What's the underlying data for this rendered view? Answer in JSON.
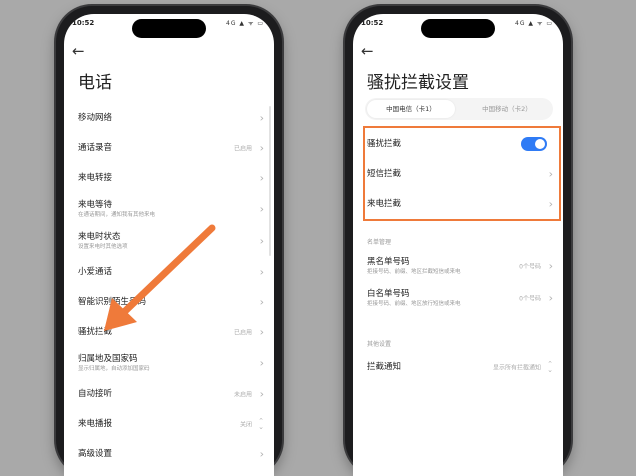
{
  "left_phone": {
    "status": {
      "time": "10:52",
      "indicators": "4G ▲ ᯤ ▭"
    },
    "title": "电话",
    "items": [
      {
        "label": "移动网络",
        "sub": "",
        "value": "",
        "control": "chevron"
      },
      {
        "label": "通话录音",
        "sub": "",
        "value": "已启用",
        "control": "chevron"
      },
      {
        "label": "来电转接",
        "sub": "",
        "value": "",
        "control": "chevron"
      },
      {
        "label": "来电等待",
        "sub": "在通话期间，通知我有其他来电",
        "value": "",
        "control": "chevron"
      },
      {
        "label": "来电时状态",
        "sub": "设置来电时其他选项",
        "value": "",
        "control": "chevron"
      },
      {
        "label": "小爱通话",
        "sub": "",
        "value": "",
        "control": "chevron"
      },
      {
        "label": "智能识别陌生号码",
        "sub": "",
        "value": "",
        "control": "chevron"
      },
      {
        "label": "骚扰拦截",
        "sub": "",
        "value": "已启用",
        "control": "chevron"
      },
      {
        "label": "归属地及国家码",
        "sub": "显示归属地，自动添加国家码",
        "value": "",
        "control": "chevron"
      },
      {
        "label": "自动接听",
        "sub": "",
        "value": "未启用",
        "control": "chevron"
      },
      {
        "label": "来电播报",
        "sub": "",
        "value": "关闭",
        "control": "updown"
      },
      {
        "label": "高级设置",
        "sub": "",
        "value": "",
        "control": "chevron"
      }
    ]
  },
  "right_phone": {
    "status": {
      "time": "10:52",
      "indicators": "4G ▲ ᯤ ▭"
    },
    "title": "骚扰拦截设置",
    "tabs": [
      {
        "label": "中国电信（卡1）",
        "active": true
      },
      {
        "label": "中国移动（卡2）",
        "active": false
      }
    ],
    "top_items": [
      {
        "label": "骚扰拦截",
        "control": "toggle",
        "on": true
      },
      {
        "label": "短信拦截",
        "control": "chevron"
      },
      {
        "label": "来电拦截",
        "control": "chevron"
      }
    ],
    "list_section": {
      "label": "名单管理",
      "items": [
        {
          "label": "黑名单号码",
          "sub": "拒接号码、前缀、地区拦截短信或来电",
          "value": "0个号码"
        },
        {
          "label": "白名单号码",
          "sub": "拒接号码、前缀、地区放行短信或来电",
          "value": "0个号码"
        }
      ]
    },
    "other_section": {
      "label": "其他设置",
      "items": [
        {
          "label": "拦截通知",
          "value": "显示所有拦截通知",
          "control": "updown"
        }
      ]
    }
  },
  "colors": {
    "highlight": "#ef7a3a",
    "arrow": "#ef7a3a",
    "toggle_on": "#2f7bf5"
  }
}
